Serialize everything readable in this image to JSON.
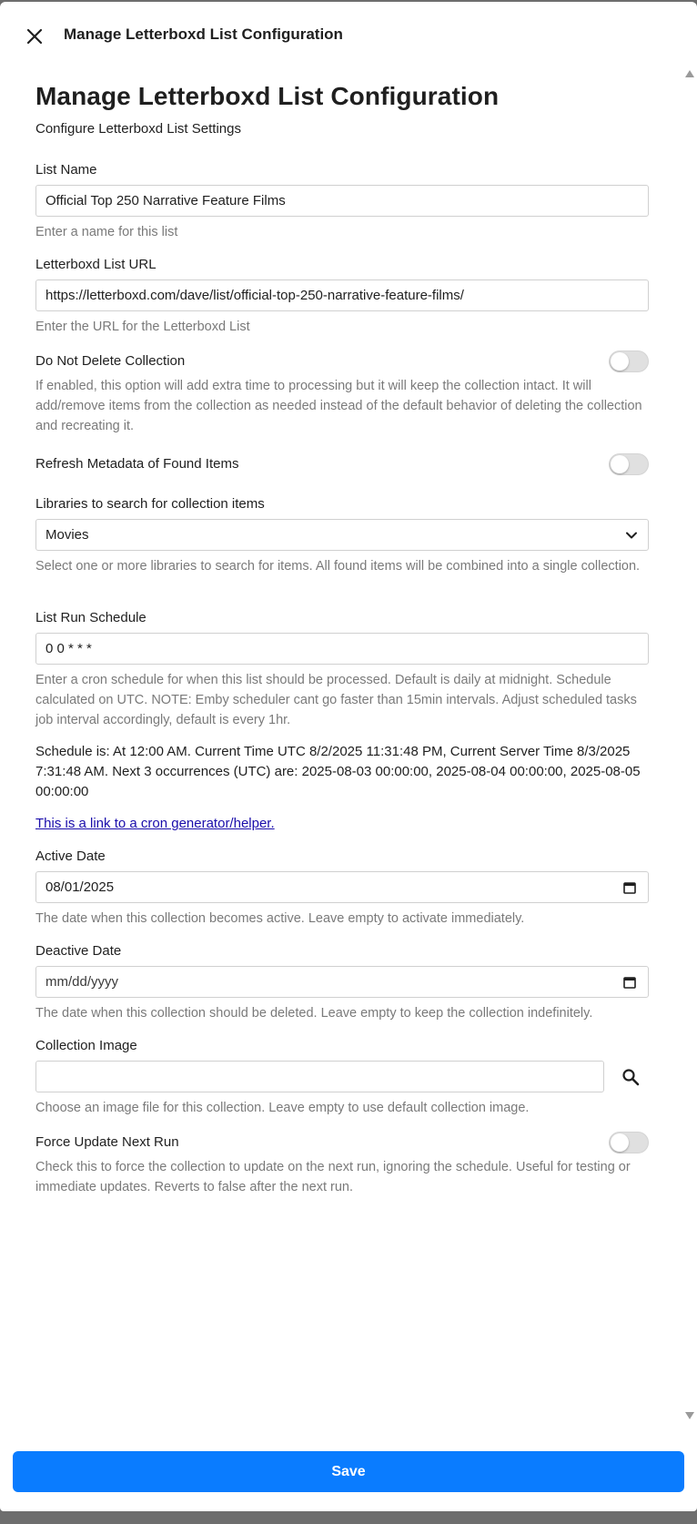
{
  "header": {
    "title": "Manage Letterboxd List Configuration"
  },
  "page": {
    "title": "Manage Letterboxd List Configuration",
    "subtitle": "Configure Letterboxd List Settings"
  },
  "fields": {
    "list_name": {
      "label": "List Name",
      "value": "Official Top 250 Narrative Feature Films",
      "help": "Enter a name for this list"
    },
    "list_url": {
      "label": "Letterboxd List URL",
      "value": "https://letterboxd.com/dave/list/official-top-250-narrative-feature-films/",
      "help": "Enter the URL for the Letterboxd List"
    },
    "do_not_delete": {
      "label": "Do Not Delete Collection",
      "enabled": false,
      "help": "If enabled, this option will add extra time to processing but it will keep the collection intact. It will add/remove items from the collection as needed instead of the default behavior of deleting the collection and recreating it."
    },
    "refresh_metadata": {
      "label": "Refresh Metadata of Found Items",
      "enabled": false
    },
    "libraries": {
      "label": "Libraries to search for collection items",
      "value": "Movies",
      "help": "Select one or more libraries to search for items. All found items will be combined into a single collection."
    },
    "run_schedule": {
      "label": "List Run Schedule",
      "value": "0 0 * * *",
      "help": "Enter a cron schedule for when this list should be processed. Default is daily at midnight. Schedule calculated on UTC. NOTE: Emby scheduler cant go faster than 15min intervals. Adjust scheduled tasks job interval accordingly, default is every 1hr."
    },
    "schedule_info": "Schedule is: At 12:00 AM. Current Time UTC 8/2/2025 11:31:48 PM, Current Server Time 8/3/2025 7:31:48 AM. Next 3 occurrences (UTC) are: 2025-08-03 00:00:00, 2025-08-04 00:00:00, 2025-08-05 00:00:00",
    "cron_link": "This is a link to a cron generator/helper.",
    "active_date": {
      "label": "Active Date",
      "value": "08/01/2025",
      "help": "The date when this collection becomes active. Leave empty to activate immediately."
    },
    "deactive_date": {
      "label": "Deactive Date",
      "value": "mm/dd/yyyy",
      "help": "The date when this collection should be deleted. Leave empty to keep the collection indefinitely."
    },
    "collection_image": {
      "label": "Collection Image",
      "value": "",
      "help": "Choose an image file for this collection. Leave empty to use default collection image."
    },
    "force_update": {
      "label": "Force Update Next Run",
      "enabled": false,
      "help": "Check this to force the collection to update on the next run, ignoring the schedule. Useful for testing or immediate updates. Reverts to false after the next run."
    }
  },
  "footer": {
    "save_label": "Save"
  },
  "colors": {
    "accent": "#0a7cff",
    "link": "#1a0dab",
    "help_text": "#7a7a7a"
  },
  "icons": {
    "close": "close-icon",
    "chevron": "chevron-down-icon",
    "calendar": "calendar-icon",
    "search": "search-icon"
  }
}
